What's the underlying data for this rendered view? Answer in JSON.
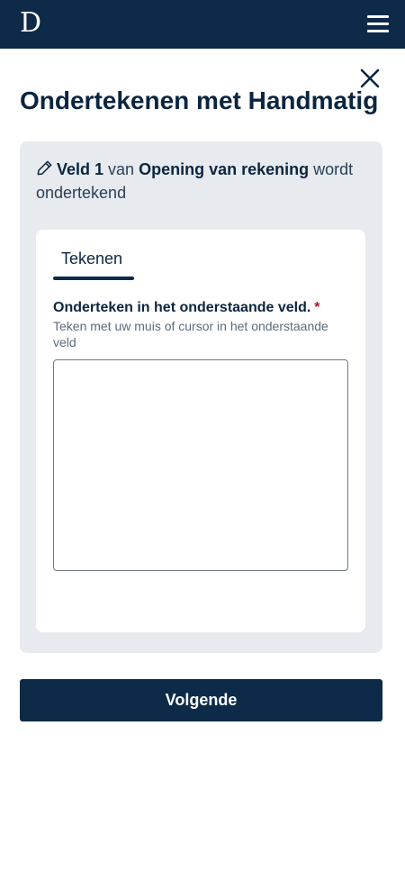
{
  "header": {
    "logo_text": "D",
    "menu_icon": "hamburger-menu-icon",
    "background": "#0d2a48"
  },
  "dialog": {
    "close_icon": "close-icon",
    "title": "Ondertekenen met Handmatig"
  },
  "panel": {
    "icon": "pencil-icon",
    "field_name": "Veld 1",
    "text_van": "van",
    "document_name": "Opening van rekening",
    "text_suffix": "wordt ondertekend"
  },
  "tabs": [
    {
      "label": "Tekenen",
      "active": true
    }
  ],
  "signature": {
    "label": "Onderteken in het onderstaande veld.",
    "required_marker": "*",
    "help": "Teken met uw muis of cursor in het onderstaande veld"
  },
  "actions": {
    "next_label": "Volgende"
  },
  "colors": {
    "brand": "#0d2a48",
    "panel_bg": "#e7ebef",
    "required": "#b0122b"
  }
}
